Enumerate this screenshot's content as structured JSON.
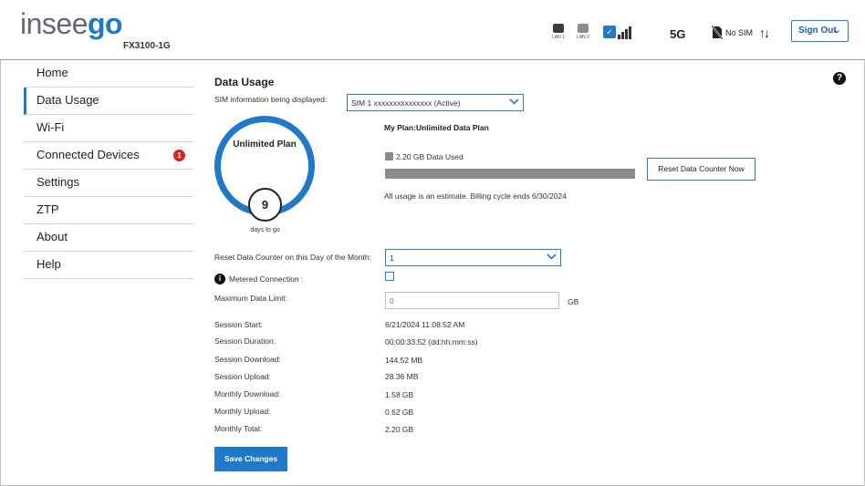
{
  "header": {
    "logo_a": "insee",
    "logo_b": "go",
    "model": "FX3100-1G",
    "lan1_label": "LAN 1",
    "lan2_label": "LAN 2",
    "network": "5G",
    "sim_status": "No SIM",
    "sign_out": "Sign Out",
    "icons": [
      "lan-port-icon",
      "wifi-icon",
      "signal-bars-icon",
      "no-sim-icon",
      "data-transfer-arrows-icon",
      "chevron-down-icon"
    ]
  },
  "sidebar": {
    "items": [
      {
        "label": "Home"
      },
      {
        "label": "Data Usage"
      },
      {
        "label": "Wi-Fi"
      },
      {
        "label": "Connected Devices",
        "badge": "1"
      },
      {
        "label": "Settings"
      },
      {
        "label": "ZTP"
      },
      {
        "label": "About"
      },
      {
        "label": "Help"
      }
    ],
    "active": "Data Usage"
  },
  "main": {
    "title": "Data Usage",
    "help_glyph": "?",
    "sim_label": "SIM information being displayed:",
    "sim_value": "SIM 1 xxxxxxxxxxxxxxx (Active)",
    "gauge_text": "Unlimited Plan",
    "days_value": "9",
    "days_label": "days to go",
    "plan": "My Plan:Unlimited Data Plan",
    "data_used": "2.20 GB Data Used",
    "usage_fraction": 1.0,
    "reset_button": "Reset Data Counter Now",
    "estimate": "All usage is an estimate. Billing cycle ends 6/30/2024",
    "reset_day_label": "Reset Data Counter on this Day of the Month:",
    "reset_day_value": "1",
    "metered_label": "Metered Connection :",
    "metered_checked": false,
    "max_limit_label": "Maximum Data Limit:",
    "max_limit_placeholder": "0",
    "max_limit_unit": "GB",
    "stats": [
      {
        "label": "Session Start:",
        "value": "6/21/2024 11:08:52 AM"
      },
      {
        "label": "Session Duration:",
        "value": "00:00:33:52 (dd:hh:mm:ss)"
      },
      {
        "label": "Session Download:",
        "value": "144.52 MB"
      },
      {
        "label": "Session Upload:",
        "value": "28.36 MB"
      },
      {
        "label": "Monthly Download:",
        "value": "1.58 GB"
      },
      {
        "label": "Monthly Upload:",
        "value": "0.62 GB"
      },
      {
        "label": "Monthly Total:",
        "value": "2.20 GB"
      }
    ],
    "save_button": "Save Changes"
  },
  "colors": {
    "accent": "#1f78c8",
    "badge": "#d81f26",
    "usage_bar": "#8c8c8c"
  }
}
